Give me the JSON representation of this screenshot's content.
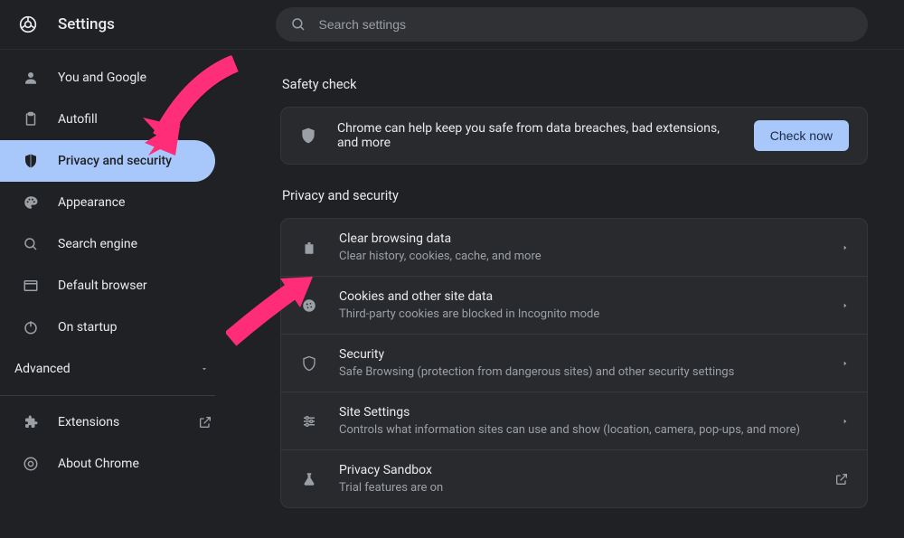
{
  "header": {
    "title": "Settings",
    "search_placeholder": "Search settings"
  },
  "sidebar": {
    "items": [
      {
        "label": "You and Google",
        "icon": "person-icon"
      },
      {
        "label": "Autofill",
        "icon": "clipboard-icon"
      },
      {
        "label": "Privacy and security",
        "icon": "shield-icon",
        "active": true
      },
      {
        "label": "Appearance",
        "icon": "palette-icon"
      },
      {
        "label": "Search engine",
        "icon": "search-icon"
      },
      {
        "label": "Default browser",
        "icon": "browser-icon"
      },
      {
        "label": "On startup",
        "icon": "power-icon"
      }
    ],
    "advanced_label": "Advanced",
    "footer": [
      {
        "label": "Extensions",
        "icon": "puzzle-icon",
        "external": true
      },
      {
        "label": "About Chrome",
        "icon": "chrome-icon",
        "external": false
      }
    ]
  },
  "main": {
    "safety": {
      "section_title": "Safety check",
      "message": "Chrome can help keep you safe from data breaches, bad extensions, and more",
      "button": "Check now"
    },
    "privacy": {
      "section_title": "Privacy and security",
      "rows": [
        {
          "title": "Clear browsing data",
          "subtitle": "Clear history, cookies, cache, and more",
          "icon": "trash-icon"
        },
        {
          "title": "Cookies and other site data",
          "subtitle": "Third-party cookies are blocked in Incognito mode",
          "icon": "cookie-icon"
        },
        {
          "title": "Security",
          "subtitle": "Safe Browsing (protection from dangerous sites) and other security settings",
          "icon": "shield-icon"
        },
        {
          "title": "Site Settings",
          "subtitle": "Controls what information sites can use and show (location, camera, pop-ups, and more)",
          "icon": "sliders-icon"
        },
        {
          "title": "Privacy Sandbox",
          "subtitle": "Trial features are on",
          "icon": "flask-icon",
          "external": true
        }
      ]
    }
  }
}
